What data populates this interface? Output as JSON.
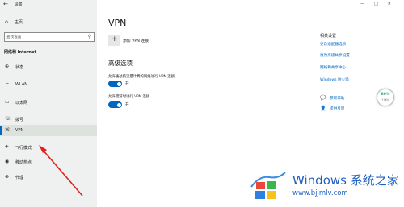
{
  "window": {
    "title": "设置",
    "controls": [
      "—",
      "□",
      "✕"
    ]
  },
  "sidebar": {
    "home_label": "主页",
    "search": {
      "placeholder": "查找设置",
      "value": ""
    },
    "section_title": "网络和 Internet",
    "items": [
      {
        "label": "状态",
        "icon": "status-icon",
        "glyph": "⊕"
      },
      {
        "label": "WLAN",
        "icon": "wifi-icon",
        "glyph": "⌔"
      },
      {
        "label": "以太网",
        "icon": "ethernet-icon",
        "glyph": "▭"
      },
      {
        "label": "拨号",
        "icon": "dialup-icon",
        "glyph": "☏"
      },
      {
        "label": "VPN",
        "icon": "vpn-icon",
        "glyph": "⌘",
        "active": true
      },
      {
        "label": "飞行模式",
        "icon": "airplane-icon",
        "glyph": "✈"
      },
      {
        "label": "移动热点",
        "icon": "hotspot-icon",
        "glyph": "◉"
      },
      {
        "label": "代理",
        "icon": "proxy-icon",
        "glyph": "⊕"
      }
    ]
  },
  "main": {
    "title": "VPN",
    "add_vpn_label": "添加 VPN 连接",
    "advanced_title": "高级选项",
    "options": [
      {
        "label": "允许通过按流量计费的网络进行 VPN 连接",
        "state": "开",
        "on": true
      },
      {
        "label": "允许漫游时进行 VPN 连接",
        "state": "开",
        "on": true
      }
    ],
    "related_title": "相关设置",
    "related_links": [
      "更改适配器选项",
      "更改高级共享设置",
      "网络和共享中心",
      "Windows 防火墙"
    ],
    "help_links": [
      {
        "label": "获取帮助",
        "icon": "help-icon",
        "glyph": "💬"
      },
      {
        "label": "提供反馈",
        "icon": "feedback-icon",
        "glyph": "👤"
      }
    ],
    "perf_badge": {
      "percent": "80%",
      "speed": "↑0K/s"
    }
  },
  "watermark": {
    "brand": "Windows 系统之家",
    "url": "www.bjjmlv.com"
  },
  "colors": {
    "accent": "#0067c0",
    "sidebar_bg": "#eef1ef",
    "arrow": "#e02020"
  }
}
